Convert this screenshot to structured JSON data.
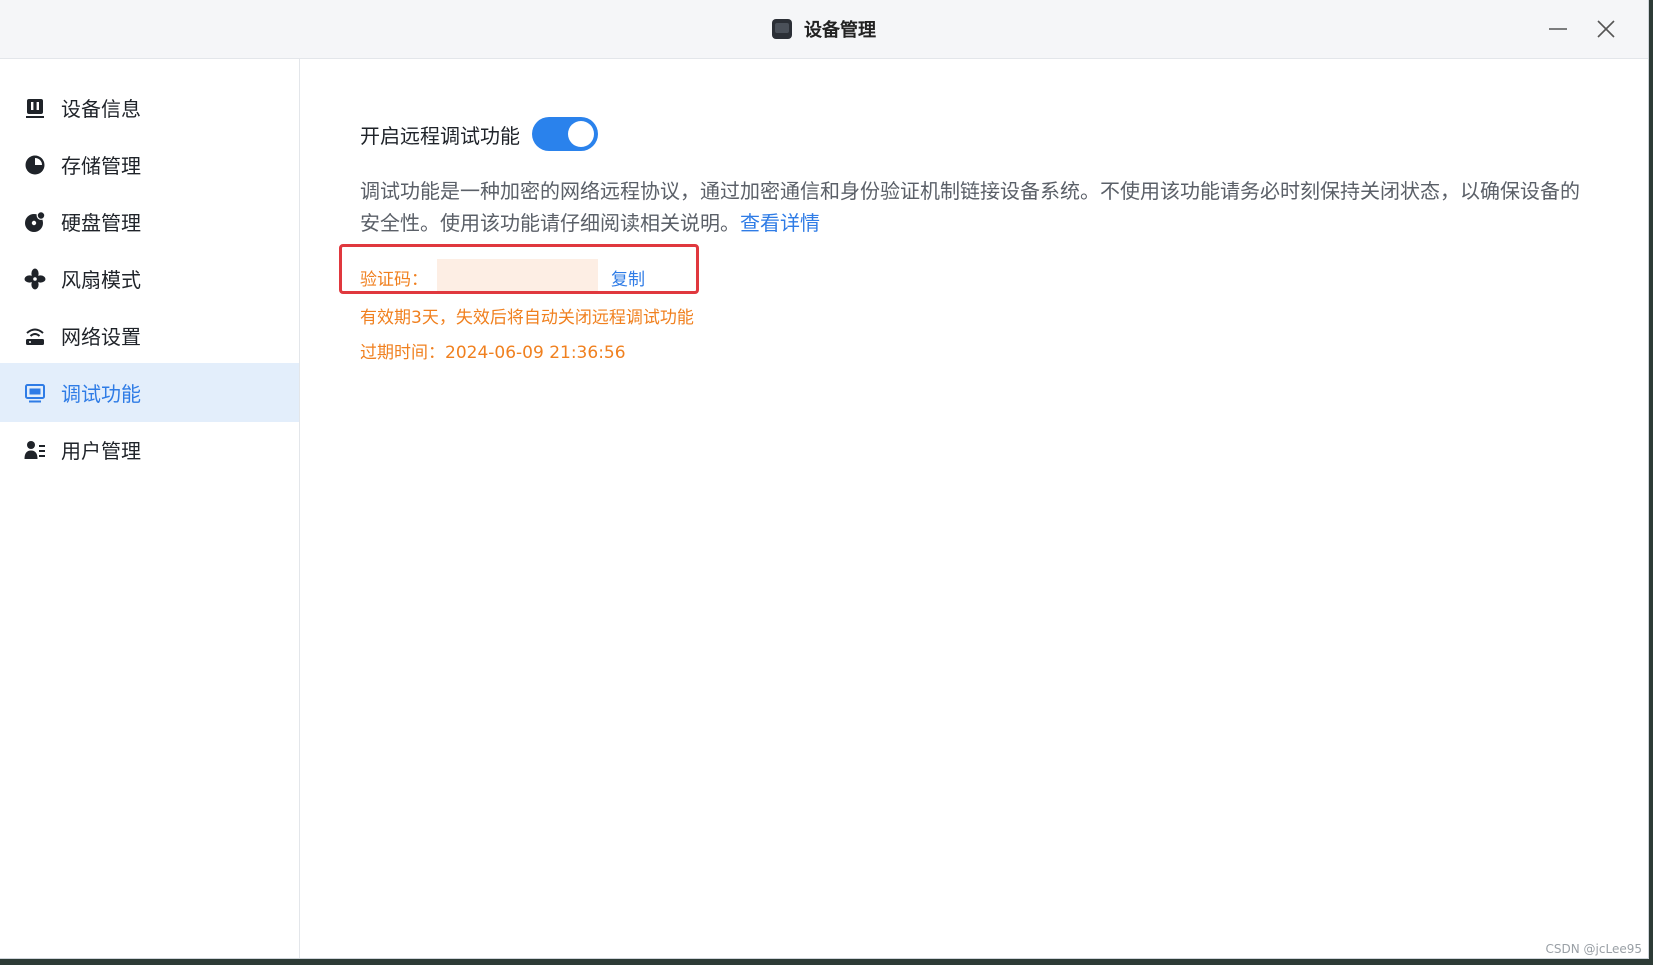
{
  "window": {
    "title": "设备管理"
  },
  "sidebar": {
    "items": [
      {
        "label": "设备信息",
        "icon": "device-info-icon"
      },
      {
        "label": "存储管理",
        "icon": "pie-chart-icon"
      },
      {
        "label": "硬盘管理",
        "icon": "disk-icon"
      },
      {
        "label": "风扇模式",
        "icon": "fan-icon"
      },
      {
        "label": "网络设置",
        "icon": "router-icon"
      },
      {
        "label": "调试功能",
        "icon": "monitor-icon",
        "active": true
      },
      {
        "label": "用户管理",
        "icon": "users-icon"
      }
    ]
  },
  "main": {
    "toggle_label": "开启远程调试功能",
    "toggle_on": true,
    "description": "调试功能是一种加密的网络远程协议，通过加密通信和身份验证机制链接设备系统。不使用该功能请务必时刻保持关闭状态，以确保设备的安全性。使用该功能请仔细阅读相关说明。",
    "details_link": "查看详情",
    "code_label": "验证码：",
    "copy_label": "复制",
    "validity_text": "有效期3天，失效后将自动关闭远程调试功能",
    "expiry_text": "过期时间：2024-06-09 21:36:56"
  },
  "watermark": "CSDN @jcLee95",
  "colors": {
    "accent": "#2f7ce6",
    "toggle": "#2a82ec",
    "warning": "#f0801f",
    "highlight_border": "#e0383e",
    "active_bg": "#e3eefb"
  }
}
